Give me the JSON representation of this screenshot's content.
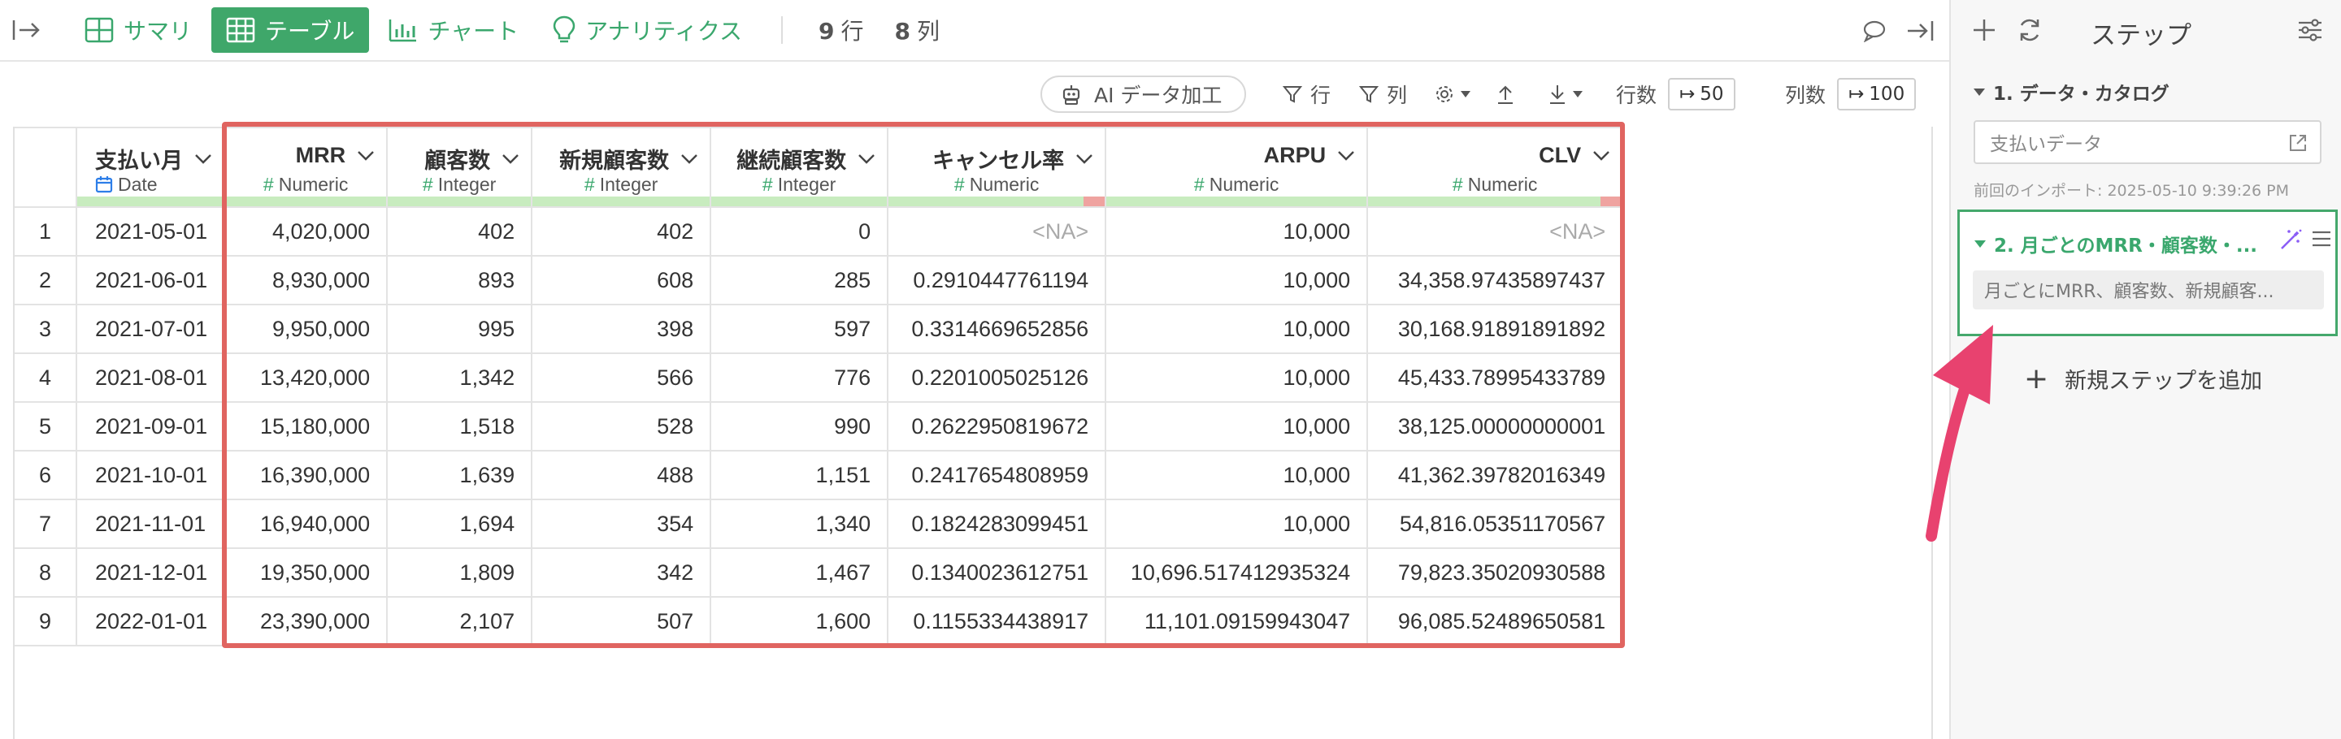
{
  "topbar": {
    "tabs": [
      {
        "label": "サマリ",
        "icon": "summary-grid-icon"
      },
      {
        "label": "テーブル",
        "icon": "table-icon"
      },
      {
        "label": "チャート",
        "icon": "bar-chart-icon"
      },
      {
        "label": "アナリティクス",
        "icon": "lightbulb-icon"
      }
    ],
    "rows_count": "9",
    "rows_unit": "行",
    "cols_count": "8",
    "cols_unit": "列",
    "active_color": "#3fa76a",
    "accent_color": "#3aa76d"
  },
  "toolbar": {
    "ai_label": "AI データ加工",
    "filter_row_label": "行",
    "filter_col_label": "列",
    "rows_label": "行数",
    "rows_value": "50",
    "cols_label": "列数",
    "cols_value": "100"
  },
  "table": {
    "columns": [
      {
        "name": "支払い月",
        "type": "Date"
      },
      {
        "name": "MRR",
        "type": "Numeric"
      },
      {
        "name": "顧客数",
        "type": "Integer"
      },
      {
        "name": "新規顧客数",
        "type": "Integer"
      },
      {
        "name": "継続顧客数",
        "type": "Integer"
      },
      {
        "name": "キャンセル率",
        "type": "Numeric"
      },
      {
        "name": "ARPU",
        "type": "Numeric"
      },
      {
        "name": "CLV",
        "type": "Numeric"
      }
    ],
    "rows": [
      [
        "1",
        "2021-05-01",
        "4,020,000",
        "402",
        "402",
        "0",
        "<NA>",
        "10,000",
        "<NA>"
      ],
      [
        "2",
        "2021-06-01",
        "8,930,000",
        "893",
        "608",
        "285",
        "0.2910447761194",
        "10,000",
        "34,358.97435897437"
      ],
      [
        "3",
        "2021-07-01",
        "9,950,000",
        "995",
        "398",
        "597",
        "0.3314669652856",
        "10,000",
        "30,168.91891891892"
      ],
      [
        "4",
        "2021-08-01",
        "13,420,000",
        "1,342",
        "566",
        "776",
        "0.2201005025126",
        "10,000",
        "45,433.78995433789"
      ],
      [
        "5",
        "2021-09-01",
        "15,180,000",
        "1,518",
        "528",
        "990",
        "0.2622950819672",
        "10,000",
        "38,125.00000000001"
      ],
      [
        "6",
        "2021-10-01",
        "16,390,000",
        "1,639",
        "488",
        "1,151",
        "0.2417654808959",
        "10,000",
        "41,362.39782016349"
      ],
      [
        "7",
        "2021-11-01",
        "16,940,000",
        "1,694",
        "354",
        "1,340",
        "0.1824283099451",
        "10,000",
        "54,816.05351170567"
      ],
      [
        "8",
        "2021-12-01",
        "19,350,000",
        "1,809",
        "342",
        "1,467",
        "0.1340023612751",
        "10,696.517412935324",
        "79,823.35020930588"
      ],
      [
        "9",
        "2022-01-01",
        "23,390,000",
        "2,107",
        "507",
        "1,600",
        "0.1155334438917",
        "11,101.09159943047",
        "96,085.52489650581"
      ]
    ],
    "highlight_color": "#e06460"
  },
  "panel": {
    "title": "ステップ",
    "step1": {
      "title": "1. データ・カタログ",
      "source": "支払いデータ",
      "imported": "前回のインポート: 2025-05-10 9:39:26 PM"
    },
    "step2": {
      "title": "2. 月ごとのMRR・顧客数・...",
      "description": "月ごとにMRR、顧客数、新規顧客..."
    },
    "add_step_label": "新規ステップを追加",
    "arrow_color": "#e8426f"
  }
}
